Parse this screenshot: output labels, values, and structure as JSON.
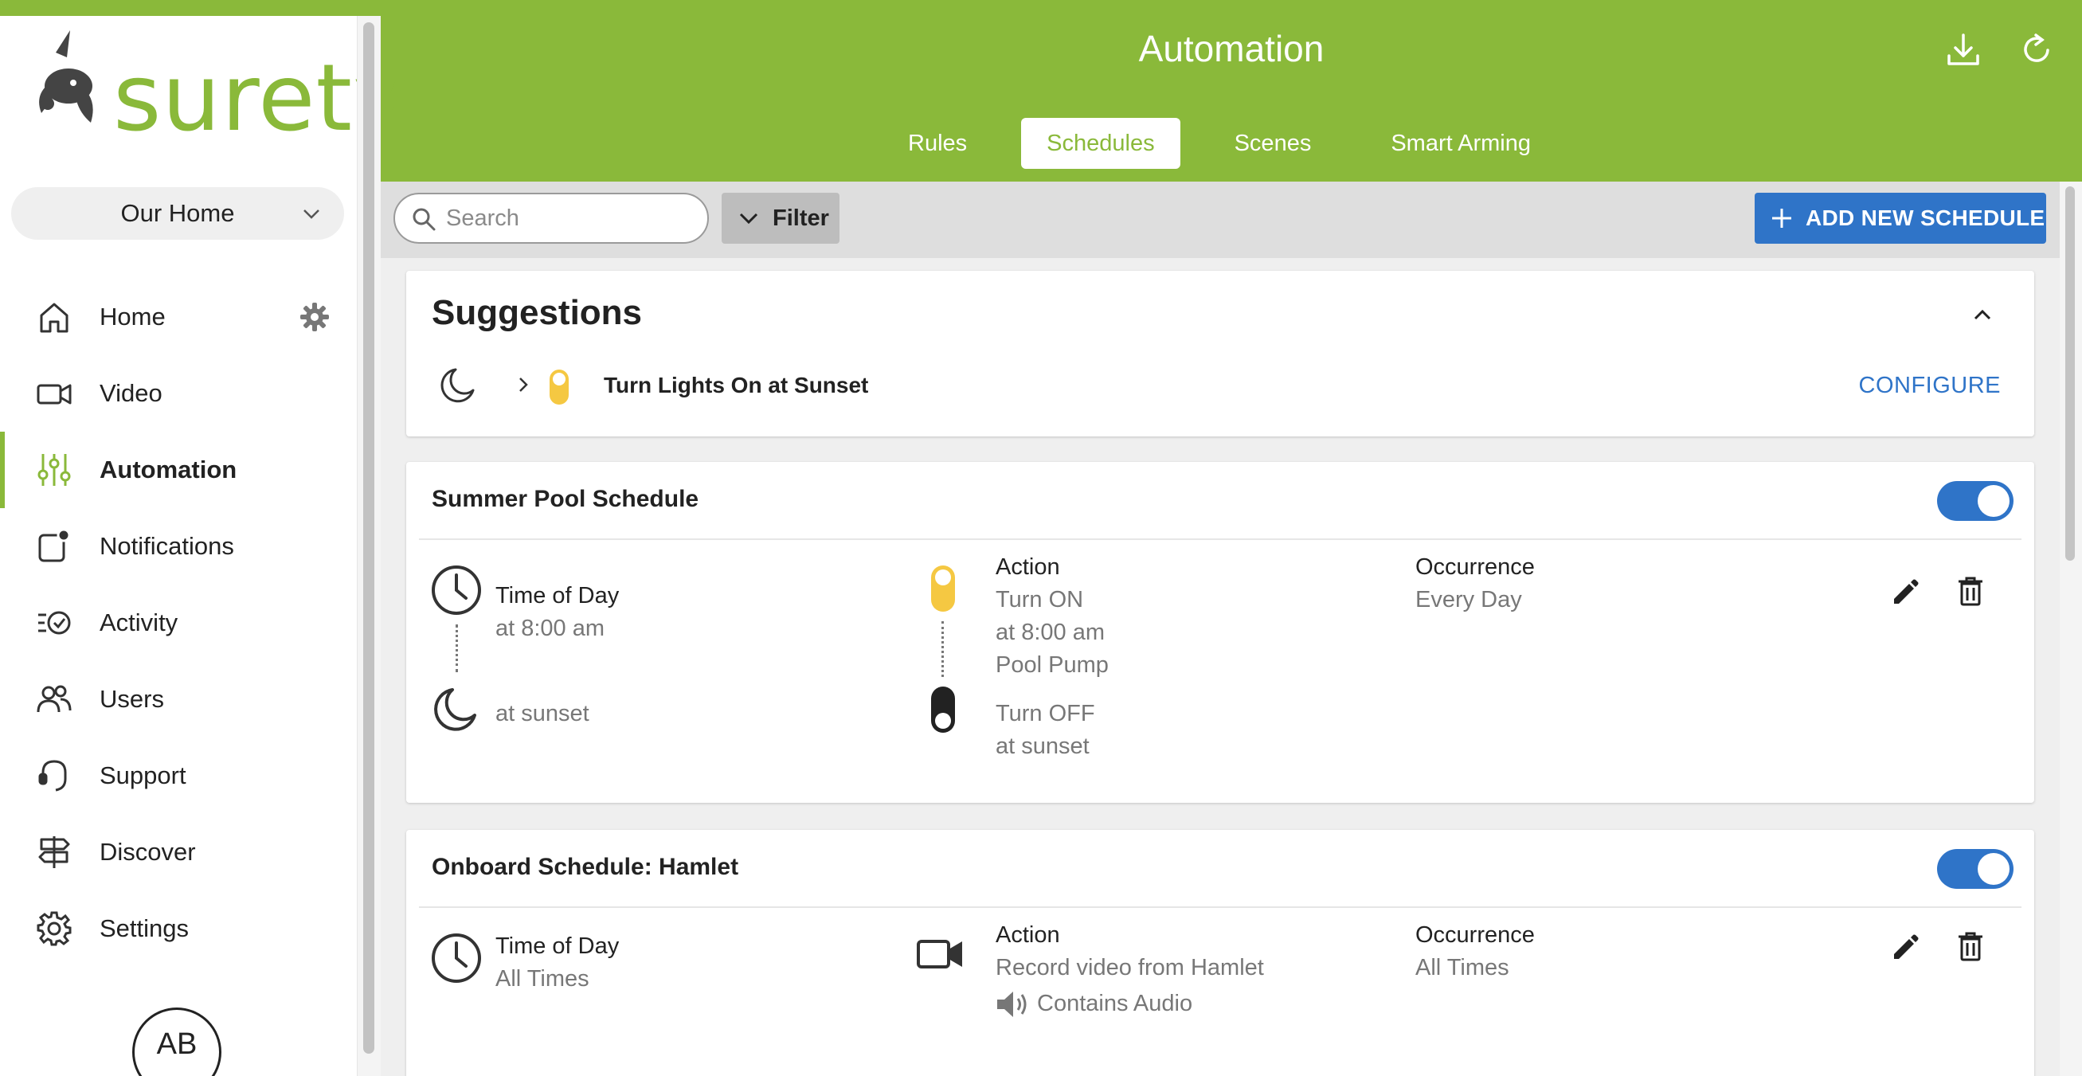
{
  "brand": {
    "name": "surety",
    "color": "#8ab93a",
    "accent": "#2f74c8"
  },
  "sidebar": {
    "location": "Our Home",
    "items": [
      {
        "label": "Home",
        "icon": "home-icon"
      },
      {
        "label": "Video",
        "icon": "video-camera-icon"
      },
      {
        "label": "Automation",
        "icon": "sliders-icon",
        "active": true
      },
      {
        "label": "Notifications",
        "icon": "notification-icon"
      },
      {
        "label": "Activity",
        "icon": "activity-icon"
      },
      {
        "label": "Users",
        "icon": "users-icon"
      },
      {
        "label": "Support",
        "icon": "headset-icon"
      },
      {
        "label": "Discover",
        "icon": "signpost-icon"
      },
      {
        "label": "Settings",
        "icon": "gear-icon"
      }
    ],
    "avatar_initials": "AB"
  },
  "header": {
    "title": "Automation",
    "tabs": [
      {
        "label": "Rules"
      },
      {
        "label": "Schedules",
        "active": true
      },
      {
        "label": "Scenes"
      },
      {
        "label": "Smart Arming"
      }
    ]
  },
  "toolbar": {
    "search_placeholder": "Search",
    "filter_label": "Filter",
    "add_label": "ADD NEW SCHEDULE"
  },
  "suggestions": {
    "title": "Suggestions",
    "item": "Turn Lights On at Sunset",
    "configure_label": "CONFIGURE"
  },
  "schedules": [
    {
      "title": "Summer Pool Schedule",
      "enabled": true,
      "trigger_label": "Time of Day",
      "trigger_time": "at 8:00 am",
      "trigger_end": "at sunset",
      "action_label": "Action",
      "action_on": "Turn ON",
      "action_on_time": "at 8:00 am",
      "action_device": "Pool Pump",
      "action_off": "Turn OFF",
      "action_off_time": "at sunset",
      "occurrence_label": "Occurrence",
      "occurrence_value": "Every Day"
    },
    {
      "title": "Onboard Schedule: Hamlet",
      "enabled": true,
      "trigger_label": "Time of Day",
      "trigger_time": "All Times",
      "action_label": "Action",
      "action_value": "Record video from Hamlet",
      "action_audio": "Contains Audio",
      "occurrence_label": "Occurrence",
      "occurrence_value": "All Times"
    }
  ]
}
